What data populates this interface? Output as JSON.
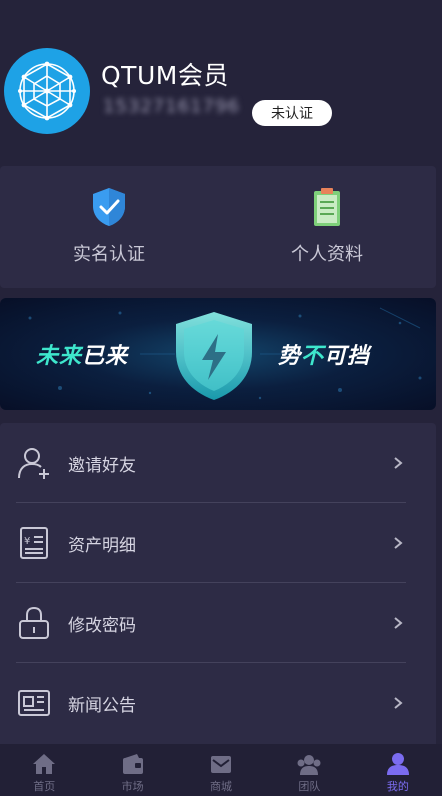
{
  "profile": {
    "username": "QTUM会员",
    "phone": "15327161796",
    "badge": "未认证",
    "avatar_color": "#1ea2e6"
  },
  "quick_actions": [
    {
      "label": "实名认证",
      "icon": "shield-check-icon"
    },
    {
      "label": "个人资料",
      "icon": "clipboard-icon"
    }
  ],
  "banner": {
    "left_highlight": "未来",
    "left_rest": "已来",
    "right_first": "势",
    "right_highlight": "不",
    "right_rest": "可挡"
  },
  "menu": [
    {
      "label": "邀请好友",
      "icon": "add-user-icon"
    },
    {
      "label": "资产明细",
      "icon": "receipt-icon"
    },
    {
      "label": "修改密码",
      "icon": "lock-icon"
    },
    {
      "label": "新闻公告",
      "icon": "news-icon"
    }
  ],
  "tabs": [
    {
      "label": "首页",
      "icon": "home-icon",
      "active": false
    },
    {
      "label": "市场",
      "icon": "wallet-icon",
      "active": false
    },
    {
      "label": "商城",
      "icon": "mail-icon",
      "active": false
    },
    {
      "label": "团队",
      "icon": "team-icon",
      "active": false
    },
    {
      "label": "我的",
      "icon": "user-icon",
      "active": true
    }
  ],
  "colors": {
    "background": "#25233a",
    "card": "#2d2b45",
    "accent": "#3ee6cc",
    "tab_active": "#7b6cf0"
  }
}
